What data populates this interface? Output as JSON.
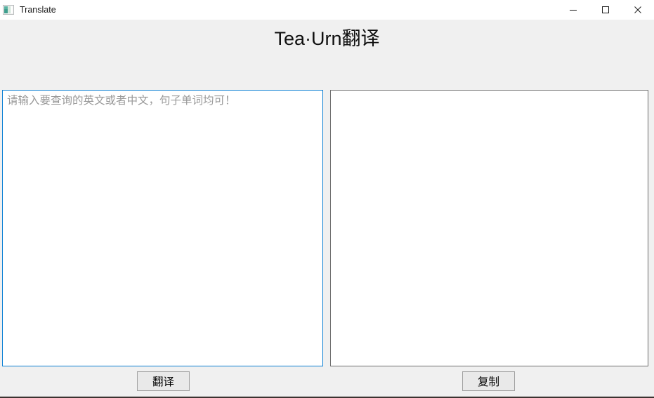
{
  "window": {
    "titlebar": {
      "icon_name": "app-logo-icon",
      "title": "Translate",
      "controls": [
        {
          "name": "minimize",
          "label": "Minimize",
          "glyph": "minimize-icon"
        },
        {
          "name": "maximize",
          "label": "Maximize",
          "glyph": "maximize-icon"
        },
        {
          "name": "close",
          "label": "Close",
          "glyph": "close-icon"
        }
      ]
    },
    "header": {
      "heading": "Tea·Urn翻译"
    },
    "panels": {
      "source": {
        "placeholder": "请输入要查询的英文或者中文，句子单词均可！",
        "value": "",
        "focused": true,
        "border_color": "#0b7fd4"
      },
      "target": {
        "placeholder": "",
        "value": "",
        "focused": false,
        "border_color": "#6e6e6e"
      }
    },
    "buttons": {
      "translate_label": "翻译",
      "copy_label": "复制"
    },
    "colors": {
      "window_background": "#f0f0f0",
      "titlebar_background": "#ffffff",
      "field_background": "#ffffff",
      "accent_focus": "#0b7fd4",
      "placeholder_text": "#9a9a9a",
      "button_face": "#e9e9e9",
      "button_border": "#a3a3a3",
      "bottom_edge": "#3b3330"
    }
  }
}
